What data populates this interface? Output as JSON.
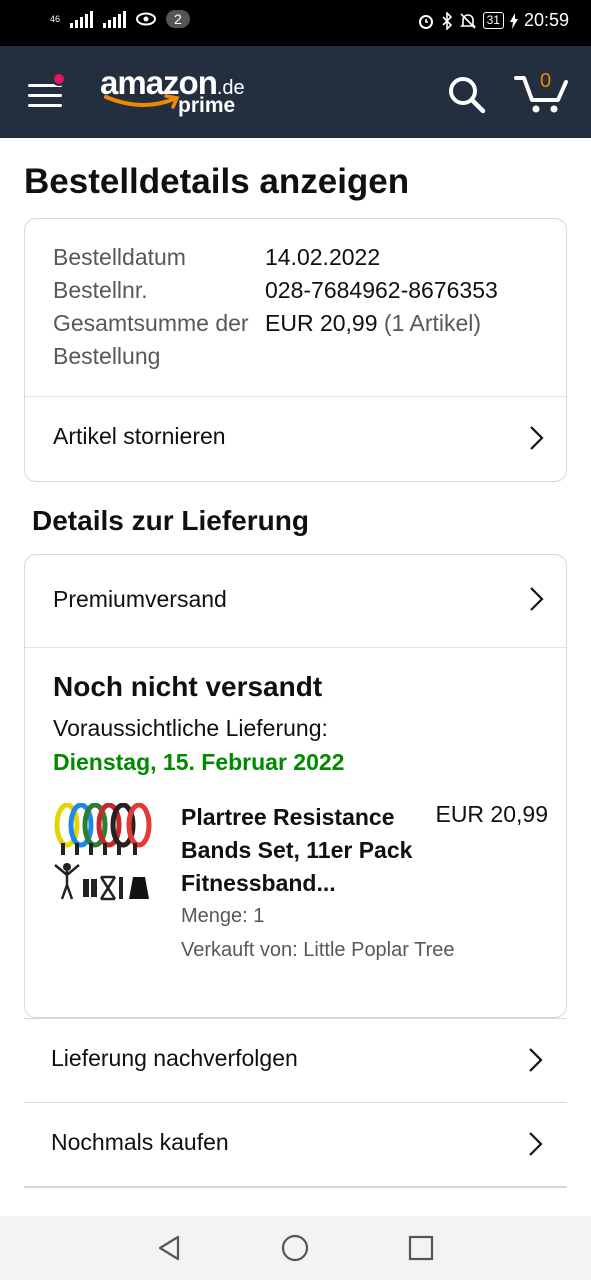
{
  "status_bar": {
    "network_label": "46",
    "notification_count": "2",
    "battery": "31",
    "time": "20:59"
  },
  "header": {
    "logo_word": "amazon",
    "logo_tld": ".de",
    "logo_sub": "prime",
    "cart_count": "0"
  },
  "page": {
    "title": "Bestelldetails anzeigen"
  },
  "order_summary": {
    "date_label": "Bestelldatum",
    "date_value": "14.02.2022",
    "number_label": "Bestellnr.",
    "number_value": "028-7684962-8676353",
    "total_label": "Gesamtsumme der Bestellung",
    "total_value": "EUR 20,99",
    "total_items": "(1 Artikel)",
    "cancel_link": "Artikel stornieren"
  },
  "delivery": {
    "section_title": "Details zur Lieferung",
    "shipping_method": "Premiumversand",
    "status": "Noch nicht versandt",
    "eta_label": "Voraussichtliche Lieferung:",
    "eta_date": "Dienstag, 15. Februar 2022",
    "item": {
      "name": "Plartree Resistance Bands Set, 11er Pack Fitnessband...",
      "price": "EUR 20,99",
      "quantity": "Menge: 1",
      "seller": "Verkauft von: Little Poplar Tree"
    }
  },
  "actions": {
    "track": "Lieferung nachverfolgen",
    "buy_again": "Nochmals kaufen"
  },
  "colors": {
    "header_bg": "#232f3e",
    "accent_orange": "#f08804",
    "eta_green": "#008a00",
    "menu_dot": "#e3175e"
  }
}
